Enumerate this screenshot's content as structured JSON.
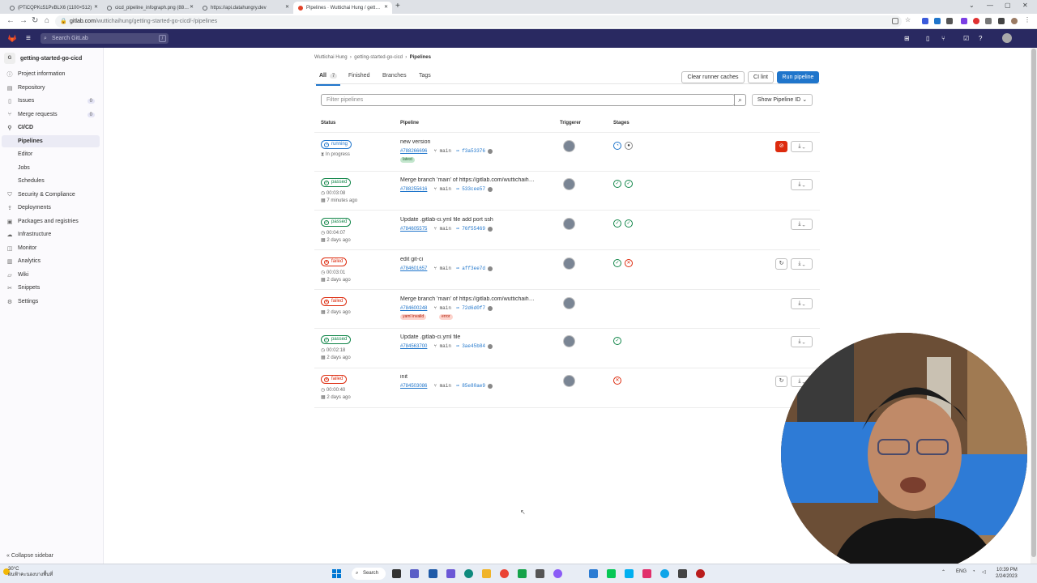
{
  "browser": {
    "tabs": [
      {
        "label": "(PTiCQPKc51PvBLX6 (1100×512)",
        "active": false
      },
      {
        "label": "cicd_pipeline_infograph.png (88…",
        "active": false
      },
      {
        "label": "https://api.datahungry.dev",
        "active": false
      },
      {
        "label": "Pipelines · Wuttichai Hung / gett…",
        "active": true
      }
    ],
    "url_host": "gitlab.com",
    "url_path": "/wuttichaihung/getting-started-go-cicd/-/pipelines"
  },
  "gitlab_nav": {
    "search_placeholder": "Search GitLab",
    "search_shortcut": "/"
  },
  "sidebar": {
    "project_avatar": "G",
    "project_name": "getting-started-go-cicd",
    "items": [
      {
        "label": "Project information",
        "icon": "info-icon"
      },
      {
        "label": "Repository",
        "icon": "repo-icon"
      },
      {
        "label": "Issues",
        "icon": "issues-icon",
        "count": "0"
      },
      {
        "label": "Merge requests",
        "icon": "merge-request-icon",
        "count": "0"
      },
      {
        "label": "CI/CD",
        "icon": "rocket-icon"
      },
      {
        "label": "Pipelines",
        "sub": true
      },
      {
        "label": "Editor",
        "sub": true
      },
      {
        "label": "Jobs",
        "sub": true
      },
      {
        "label": "Schedules",
        "sub": true
      },
      {
        "label": "Security & Compliance",
        "icon": "shield-icon"
      },
      {
        "label": "Deployments",
        "icon": "deployments-icon"
      },
      {
        "label": "Packages and registries",
        "icon": "package-icon"
      },
      {
        "label": "Infrastructure",
        "icon": "cloud-icon"
      },
      {
        "label": "Monitor",
        "icon": "monitor-icon"
      },
      {
        "label": "Analytics",
        "icon": "chart-icon"
      },
      {
        "label": "Wiki",
        "icon": "book-icon"
      },
      {
        "label": "Snippets",
        "icon": "snippet-icon"
      },
      {
        "label": "Settings",
        "icon": "gear-icon"
      }
    ],
    "collapse_label": "Collapse sidebar"
  },
  "breadcrumb": [
    "Wuttichai Hung",
    "getting-started-go-cicd",
    "Pipelines"
  ],
  "pipeline_tabs": {
    "all": "All",
    "all_count": "7",
    "finished": "Finished",
    "branches": "Branches",
    "tags": "Tags"
  },
  "actions": {
    "clear_caches": "Clear runner caches",
    "ci_lint": "CI lint",
    "run_pipeline": "Run pipeline"
  },
  "filter": {
    "placeholder": "Filter pipelines",
    "show_id": "Show Pipeline ID"
  },
  "columns": {
    "status": "Status",
    "pipeline": "Pipeline",
    "triggerer": "Triggerer",
    "stages": "Stages"
  },
  "pipelines": [
    {
      "status": "running",
      "meta": [
        "In progress"
      ],
      "title": "new version",
      "id": "#788266696",
      "branch": "main",
      "sha": "f3a53376",
      "tags": [
        {
          "label": "latest",
          "kind": "latest"
        }
      ],
      "stages": [
        "run",
        "pend"
      ],
      "actions": [
        "cancel",
        "download"
      ]
    },
    {
      "status": "passed",
      "meta": [
        "00:03:08",
        "7 minutes ago"
      ],
      "title": "Merge branch 'main' of https://gitlab.com/wuttichaih…",
      "id": "#788255616",
      "branch": "main",
      "sha": "533cee57",
      "tags": [],
      "stages": [
        "ok",
        "ok"
      ],
      "actions": [
        "download"
      ]
    },
    {
      "status": "passed",
      "meta": [
        "00:04:07",
        "2 days ago"
      ],
      "title": "Update .gitlab-ci.yml file add port ssh",
      "id": "#784605575",
      "branch": "main",
      "sha": "76f55469",
      "tags": [],
      "stages": [
        "ok",
        "ok"
      ],
      "actions": [
        "download"
      ]
    },
    {
      "status": "failed",
      "meta": [
        "00:03:01",
        "2 days ago"
      ],
      "title": "edit git-ci",
      "id": "#784601657",
      "branch": "main",
      "sha": "aff3ee7d",
      "tags": [],
      "stages": [
        "ok",
        "bad"
      ],
      "actions": [
        "retry",
        "download"
      ]
    },
    {
      "status": "failed",
      "meta": [
        "2 days ago"
      ],
      "title": "Merge branch 'main' of https://gitlab.com/wuttichaih…",
      "id": "#784600248",
      "branch": "main",
      "sha": "72d6d0f7",
      "tags": [
        {
          "label": "yaml invalid",
          "kind": "red"
        },
        {
          "label": "error",
          "kind": "red"
        }
      ],
      "stages": [],
      "actions": [
        "download"
      ]
    },
    {
      "status": "passed",
      "meta": [
        "00:02:18",
        "2 days ago"
      ],
      "title": "Update .gitlab-ci.yml file",
      "id": "#784563700",
      "branch": "main",
      "sha": "3ae45b84",
      "tags": [],
      "stages": [
        "ok"
      ],
      "actions": [
        "download"
      ]
    },
    {
      "status": "failed",
      "meta": [
        "00:00:40",
        "2 days ago"
      ],
      "title": "init",
      "id": "#784503086",
      "branch": "main",
      "sha": "85e80ae9",
      "tags": [],
      "stages": [
        "bad"
      ],
      "actions": [
        "retry",
        "download"
      ]
    }
  ],
  "taskbar": {
    "weather_temp": "30°C",
    "weather_desc": "ฝนฟ้าคะนองบางพื้นที่",
    "search_label": "Search",
    "lang": "ENG",
    "time": "10:39 PM",
    "date": "2/24/2023"
  },
  "colors": {
    "gitlab_topbar": "#292961",
    "primary": "#1f75cb",
    "success": "#108548",
    "danger": "#dd2b0e"
  }
}
